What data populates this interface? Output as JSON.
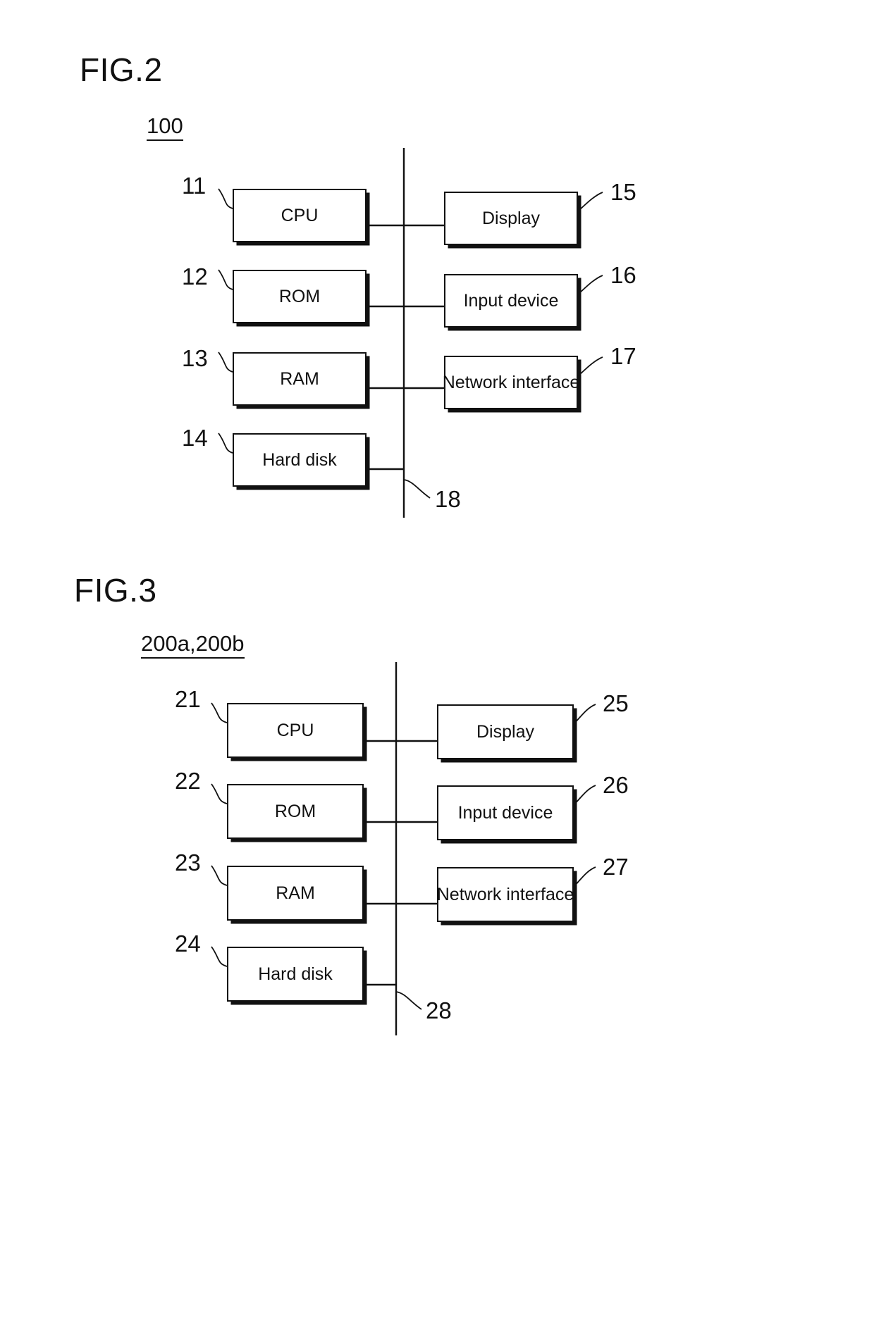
{
  "document": {
    "type": "patent-figure-sheet",
    "background_color": "#ffffff",
    "line_color": "#111111"
  },
  "figures": [
    {
      "id": "fig2",
      "title": "FIG.2",
      "system_ref": "100",
      "bus_ref": "18",
      "left_blocks": [
        {
          "ref": "11",
          "label": "CPU"
        },
        {
          "ref": "12",
          "label": "ROM"
        },
        {
          "ref": "13",
          "label": "RAM"
        },
        {
          "ref": "14",
          "label": "Hard disk"
        }
      ],
      "right_blocks": [
        {
          "ref": "15",
          "label": "Display"
        },
        {
          "ref": "16",
          "label": "Input device"
        },
        {
          "ref": "17",
          "label": "Network interface"
        }
      ]
    },
    {
      "id": "fig3",
      "title": "FIG.3",
      "system_ref": "200a,200b",
      "bus_ref": "28",
      "left_blocks": [
        {
          "ref": "21",
          "label": "CPU"
        },
        {
          "ref": "22",
          "label": "ROM"
        },
        {
          "ref": "23",
          "label": "RAM"
        },
        {
          "ref": "24",
          "label": "Hard disk"
        }
      ],
      "right_blocks": [
        {
          "ref": "25",
          "label": "Display"
        },
        {
          "ref": "26",
          "label": "Input device"
        },
        {
          "ref": "27",
          "label": "Network interface"
        }
      ]
    }
  ]
}
